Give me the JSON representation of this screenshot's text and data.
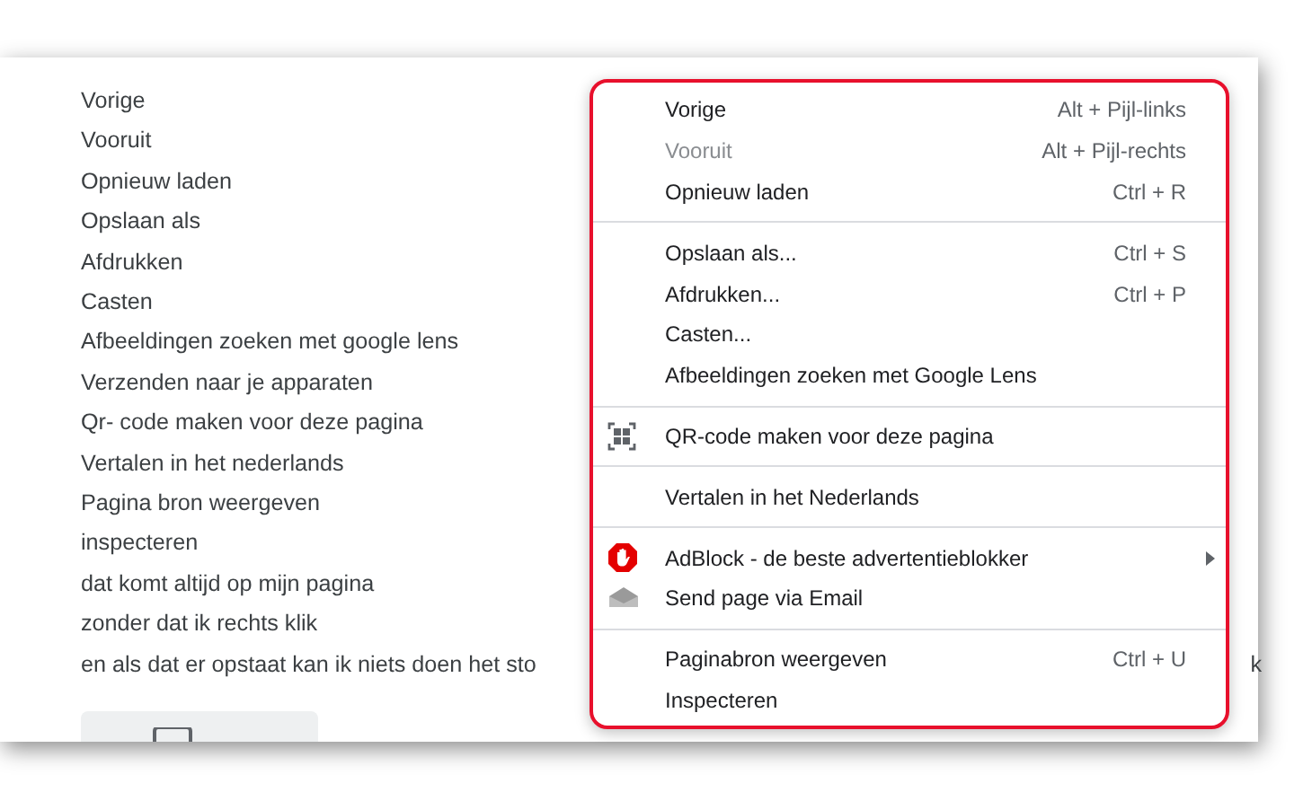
{
  "page_lines": [
    "Vorige",
    "Vooruit",
    "Opnieuw laden",
    "Opslaan als",
    "Afdrukken",
    "Casten",
    "Afbeeldingen zoeken met google lens",
    "Verzenden naar je apparaten",
    "Qr- code maken voor deze pagina",
    "Vertalen in het nederlands",
    "Pagina bron weergeven",
    "inspecteren",
    "dat komt altijd op mijn pagina",
    "zonder dat ik rechts klik"
  ],
  "covered_line": {
    "start": "en als dat er opstaat kan ik niets doen het sto",
    "end": "k"
  },
  "context_menu": {
    "groups": [
      [
        {
          "label": "Vorige",
          "shortcut": "Alt + Pijl-links",
          "disabled": false
        },
        {
          "label": "Vooruit",
          "shortcut": "Alt + Pijl-rechts",
          "disabled": true
        },
        {
          "label": "Opnieuw laden",
          "shortcut": "Ctrl + R",
          "disabled": false
        }
      ],
      [
        {
          "label": "Opslaan als...",
          "shortcut": "Ctrl + S",
          "disabled": false
        },
        {
          "label": "Afdrukken...",
          "shortcut": "Ctrl + P",
          "disabled": false
        },
        {
          "label": "Casten...",
          "disabled": false
        },
        {
          "label": "Afbeeldingen zoeken met Google Lens",
          "disabled": false
        }
      ],
      [
        {
          "label": "QR-code maken voor deze pagina",
          "kind": "qr",
          "disabled": false
        }
      ],
      [
        {
          "label": "Vertalen in het Nederlands",
          "disabled": false
        }
      ],
      [
        {
          "label": "AdBlock - de beste advertentieblokker",
          "kind": "adblock",
          "submenu": true,
          "disabled": false
        },
        {
          "label": "Send page via Email",
          "kind": "mail",
          "disabled": false
        }
      ],
      [
        {
          "label": "Paginabron weergeven",
          "shortcut": "Ctrl + U",
          "disabled": false
        },
        {
          "label": "Inspecteren",
          "disabled": false
        }
      ]
    ]
  }
}
